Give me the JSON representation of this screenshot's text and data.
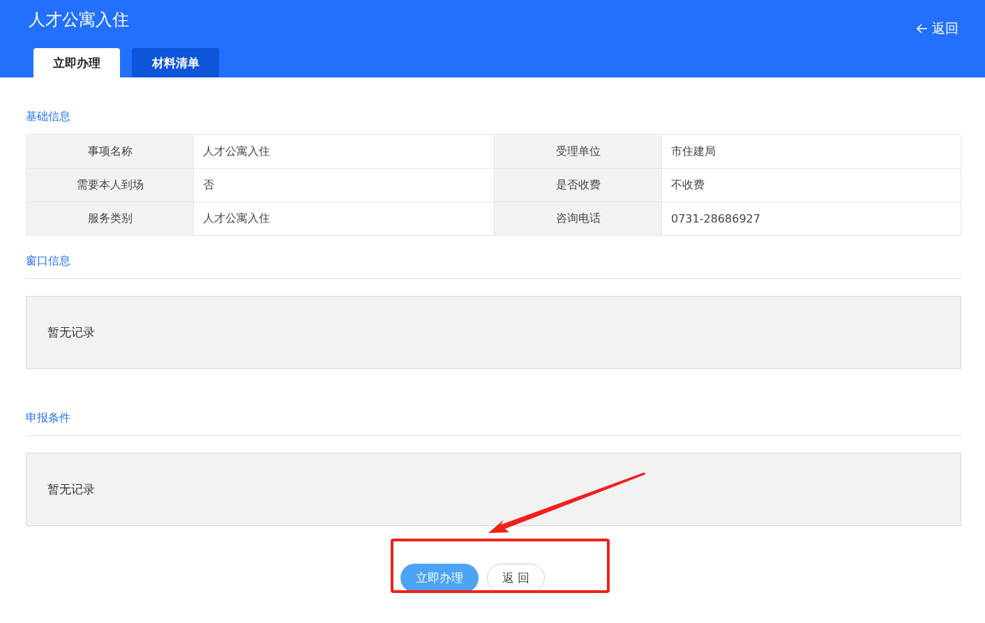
{
  "header": {
    "title": "人才公寓入住",
    "back": "返回"
  },
  "tabs": [
    {
      "label": "立即办理",
      "selected": true
    },
    {
      "label": "材料清单",
      "selected": false
    }
  ],
  "sections": [
    {
      "title": "基础信息",
      "kind": "table",
      "rows": [
        [
          "事项名称",
          "人才公寓入住",
          "受理单位",
          "市住建局"
        ],
        [
          "需要本人到场",
          "否",
          "是否收费",
          "不收费"
        ],
        [
          "服务类别",
          "人才公寓入住",
          "咨询电话",
          "0731-28686927"
        ]
      ]
    },
    {
      "title": "窗口信息",
      "kind": "empty",
      "message": "暂无记录"
    },
    {
      "title": "申报条件",
      "kind": "empty",
      "message": "暂无记录"
    }
  ],
  "buttons": [
    {
      "label": "立即办理",
      "kind": "primary"
    },
    {
      "label": "返 回",
      "kind": "default"
    }
  ]
}
